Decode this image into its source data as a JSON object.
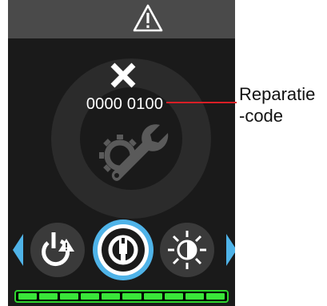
{
  "device": {
    "status_icon": "warning-triangle-icon",
    "error_code": "0000 0100",
    "error_icon": "close-x-icon",
    "illustration_icon": "gear-wrench-icon"
  },
  "menu": {
    "items": [
      {
        "icon": "power-warning-icon"
      },
      {
        "icon": "wrench-service-icon",
        "selected": true
      },
      {
        "icon": "brightness-icon"
      }
    ],
    "nav_left_icon": "arrow-left-icon",
    "nav_right_icon": "arrow-right-icon"
  },
  "progress": {
    "segments": 10,
    "filled": 10,
    "fraction": 1.0
  },
  "callout": {
    "label": "Reparatie\n-code"
  },
  "colors": {
    "screen_bg": "#1a1a1a",
    "status_bar_bg": "#4a4a4a",
    "accent_blue": "#4fb3e8",
    "progress_green": "#39e639",
    "callout_red": "#d91f26"
  }
}
